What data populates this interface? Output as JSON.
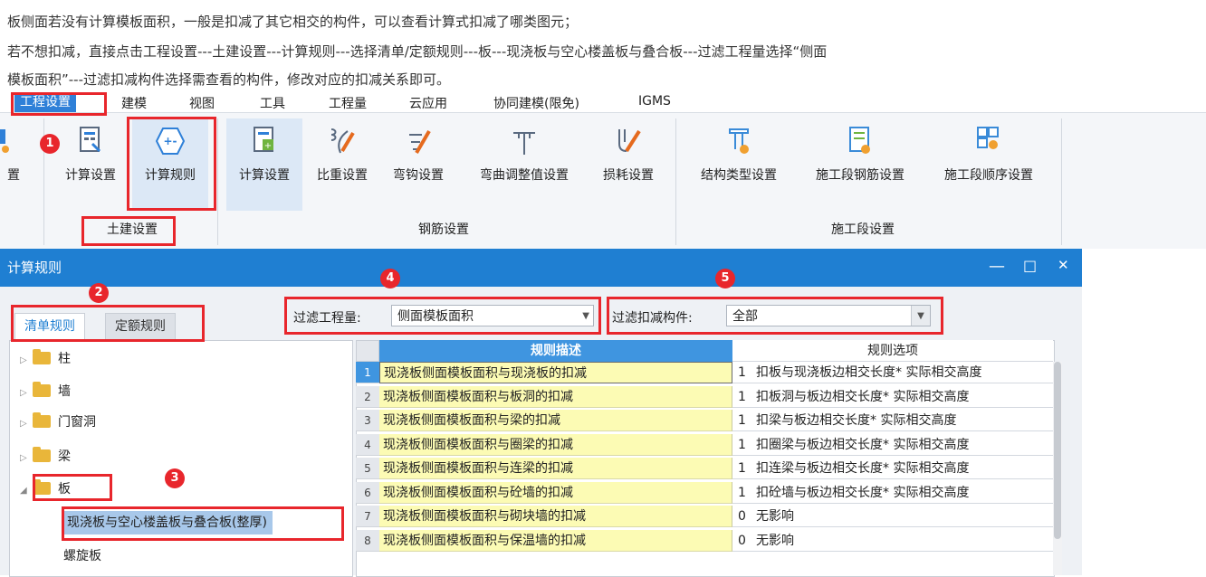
{
  "intro": {
    "line1": "板侧面若没有计算模板面积，一般是扣减了其它相交的构件，可以查看计算式扣减了哪类图元；",
    "line2": "若不想扣减，直接点击工程设置---土建设置---计算规则---选择清单/定额规则---板---现浇板与空心楼盖板与叠合板---过滤工程量选择“侧面",
    "line3": "模板面积”---过滤扣减构件选择需查看的构件，修改对应的扣减关系即可。"
  },
  "menu": [
    "工程设置",
    "建模",
    "视图",
    "工具",
    "工程量",
    "云应用",
    "协同建模(限免)",
    "IGMS"
  ],
  "ribbon": {
    "cut_label": "置",
    "tujian": {
      "label": "土建设置",
      "buttons": [
        "计算设置",
        "计算规则"
      ]
    },
    "gangjin": {
      "label": "钢筋设置",
      "buttons": [
        "计算设置",
        "比重设置",
        "弯钩设置",
        "弯曲调整值设置",
        "损耗设置"
      ]
    },
    "shigong": {
      "label": "施工段设置",
      "buttons": [
        "结构类型设置",
        "施工段钢筋设置",
        "施工段顺序设置"
      ]
    }
  },
  "badges": [
    "1",
    "2",
    "3",
    "4",
    "5"
  ],
  "dialog": {
    "title": "计算规则",
    "controls": {
      "minimize": "—",
      "maximize": "□",
      "close": "✕"
    },
    "tabs": [
      "清单规则",
      "定额规则"
    ],
    "filter_quantity": {
      "label": "过滤工程量:",
      "value": "侧面模板面积"
    },
    "filter_deduct": {
      "label": "过滤扣减构件:",
      "value": "全部"
    },
    "tree": [
      "柱",
      "墙",
      "门窗洞",
      "梁",
      "板"
    ],
    "tree_children": [
      "现浇板与空心楼盖板与叠合板(整厚)",
      "螺旋板"
    ],
    "grid": {
      "headers": [
        "规则描述",
        "规则选项"
      ],
      "rows": [
        {
          "n": "1",
          "desc": "现浇板侧面模板面积与现浇板的扣减",
          "k": "1",
          "opt": "扣板与现浇板边相交长度* 实际相交高度"
        },
        {
          "n": "2",
          "desc": "现浇板侧面模板面积与板洞的扣减",
          "k": "1",
          "opt": "扣板洞与板边相交长度* 实际相交高度"
        },
        {
          "n": "3",
          "desc": "现浇板侧面模板面积与梁的扣减",
          "k": "1",
          "opt": "扣梁与板边相交长度* 实际相交高度"
        },
        {
          "n": "4",
          "desc": "现浇板侧面模板面积与圈梁的扣减",
          "k": "1",
          "opt": "扣圈梁与板边相交长度* 实际相交高度"
        },
        {
          "n": "5",
          "desc": "现浇板侧面模板面积与连梁的扣减",
          "k": "1",
          "opt": "扣连梁与板边相交长度* 实际相交高度"
        },
        {
          "n": "6",
          "desc": "现浇板侧面模板面积与砼墙的扣减",
          "k": "1",
          "opt": "扣砼墙与板边相交长度* 实际相交高度"
        },
        {
          "n": "7",
          "desc": "现浇板侧面模板面积与砌块墙的扣减",
          "k": "0",
          "opt": "无影响"
        },
        {
          "n": "8",
          "desc": "现浇板侧面模板面积与保温墙的扣减",
          "k": "0",
          "opt": "无影响"
        }
      ]
    }
  },
  "colors": {
    "accent": "#1f7fd2",
    "annotation": "#e8262c",
    "cell_yellow": "#fcfbb4"
  }
}
